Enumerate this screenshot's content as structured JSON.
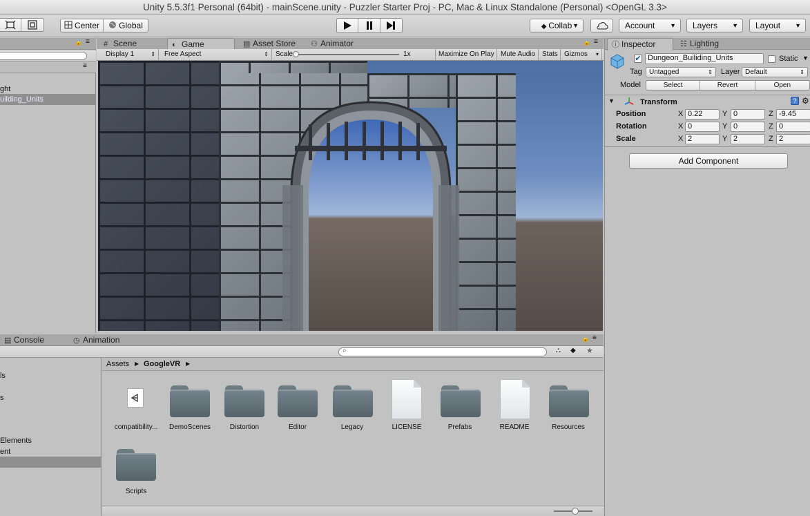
{
  "window": {
    "title": "Unity 5.5.3f1 Personal (64bit) - mainScene.unity - Puzzler Starter Proj - PC, Mac & Linux Standalone (Personal) <OpenGL 3.3>"
  },
  "toolbar": {
    "pivot": "Center",
    "space": "Global",
    "collab": "Collab",
    "account": "Account",
    "layers": "Layers",
    "layout": "Layout",
    "play_icon": "play-icon",
    "pause_icon": "pause-icon",
    "step_icon": "step-icon"
  },
  "hierarchy": {
    "items": [
      {
        "label": "ght",
        "selected": false
      },
      {
        "label": "uilding_Units",
        "selected": true
      }
    ]
  },
  "center_tabs": [
    {
      "label": "Scene",
      "icon": "grid-icon",
      "active": false
    },
    {
      "label": "Game",
      "icon": "game-icon",
      "active": true
    },
    {
      "label": "Asset Store",
      "icon": "store-icon",
      "active": false
    },
    {
      "label": "Animator",
      "icon": "animator-icon",
      "active": false
    }
  ],
  "game_bar": {
    "display": "Display 1",
    "aspect": "Free Aspect",
    "scale_label": "Scale",
    "scale_value": "1x",
    "maximize": "Maximize On Play",
    "mute": "Mute Audio",
    "stats": "Stats",
    "gizmos": "Gizmos"
  },
  "bottom_tabs": [
    {
      "label": "Console",
      "icon": "console-icon"
    },
    {
      "label": "Animation",
      "icon": "clock-icon"
    }
  ],
  "project": {
    "breadcrumb": [
      "Assets",
      "GoogleVR"
    ],
    "left_items": [
      {
        "label": "ls",
        "selected": false
      },
      {
        "label": "s",
        "selected": false
      },
      {
        "label": "Elements",
        "selected": false
      },
      {
        "label": "ent",
        "selected": false
      },
      {
        "label": "",
        "selected": true
      }
    ],
    "assets": [
      {
        "name": "compatibility...",
        "kind": "unity-doc"
      },
      {
        "name": "DemoScenes",
        "kind": "folder"
      },
      {
        "name": "Distortion",
        "kind": "folder"
      },
      {
        "name": "Editor",
        "kind": "folder"
      },
      {
        "name": "Legacy",
        "kind": "folder"
      },
      {
        "name": "LICENSE",
        "kind": "doc"
      },
      {
        "name": "Prefabs",
        "kind": "folder"
      },
      {
        "name": "README",
        "kind": "doc"
      },
      {
        "name": "Resources",
        "kind": "folder"
      },
      {
        "name": "Scripts",
        "kind": "folder"
      }
    ]
  },
  "inspector": {
    "tabs": [
      {
        "label": "Inspector",
        "icon": "info-icon"
      },
      {
        "label": "Lighting",
        "icon": "lighting-icon"
      }
    ],
    "object_name": "Dungeon_Builiding_Units",
    "static_label": "Static",
    "tag_label": "Tag",
    "tag_value": "Untagged",
    "layer_label": "Layer",
    "layer_value": "Default",
    "model_label": "Model",
    "model_buttons": [
      "Select",
      "Revert",
      "Open"
    ],
    "transform": {
      "title": "Transform",
      "rows": [
        {
          "label": "Position",
          "x": "0.22",
          "y": "0",
          "z": "-9.45"
        },
        {
          "label": "Rotation",
          "x": "0",
          "y": "0",
          "z": "0"
        },
        {
          "label": "Scale",
          "x": "2",
          "y": "2",
          "z": "2"
        }
      ]
    },
    "add_component": "Add Component"
  }
}
